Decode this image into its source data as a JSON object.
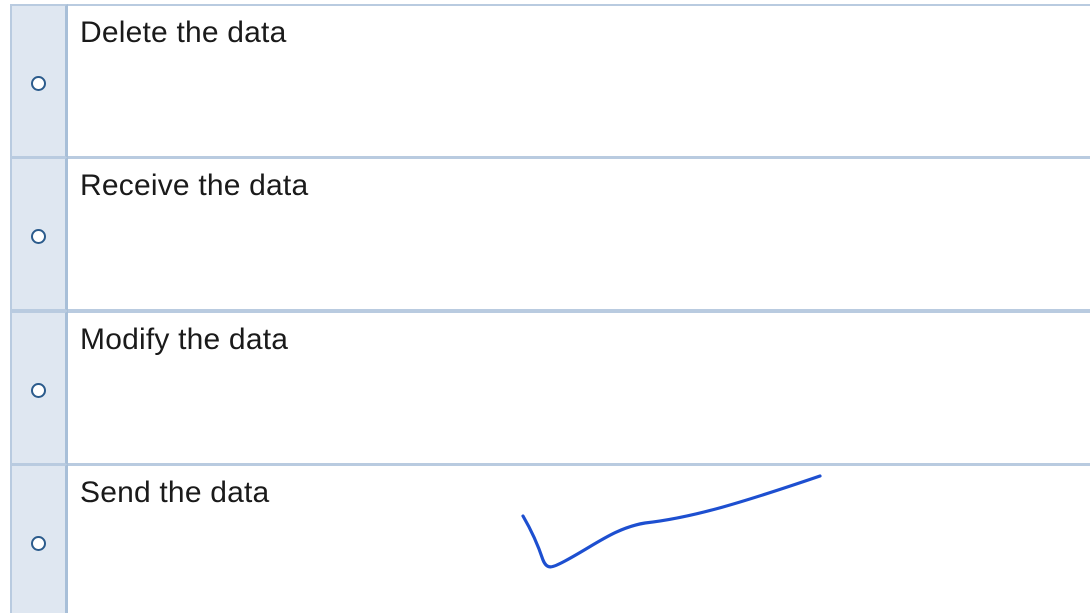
{
  "options": [
    {
      "label": "Delete the data",
      "selected": false
    },
    {
      "label": "Receive the data",
      "selected": false
    },
    {
      "label": "Modify the data",
      "selected": false
    },
    {
      "label": "Send the data",
      "selected": false
    }
  ],
  "colors": {
    "radio_cell_bg": "#dfe7f1",
    "border": "#b9cbe0",
    "radio_ring": "#2b5b8c",
    "checkmark": "#1d4fd0"
  },
  "annotation": {
    "type": "handwritten-checkmark",
    "on_option": 3
  }
}
